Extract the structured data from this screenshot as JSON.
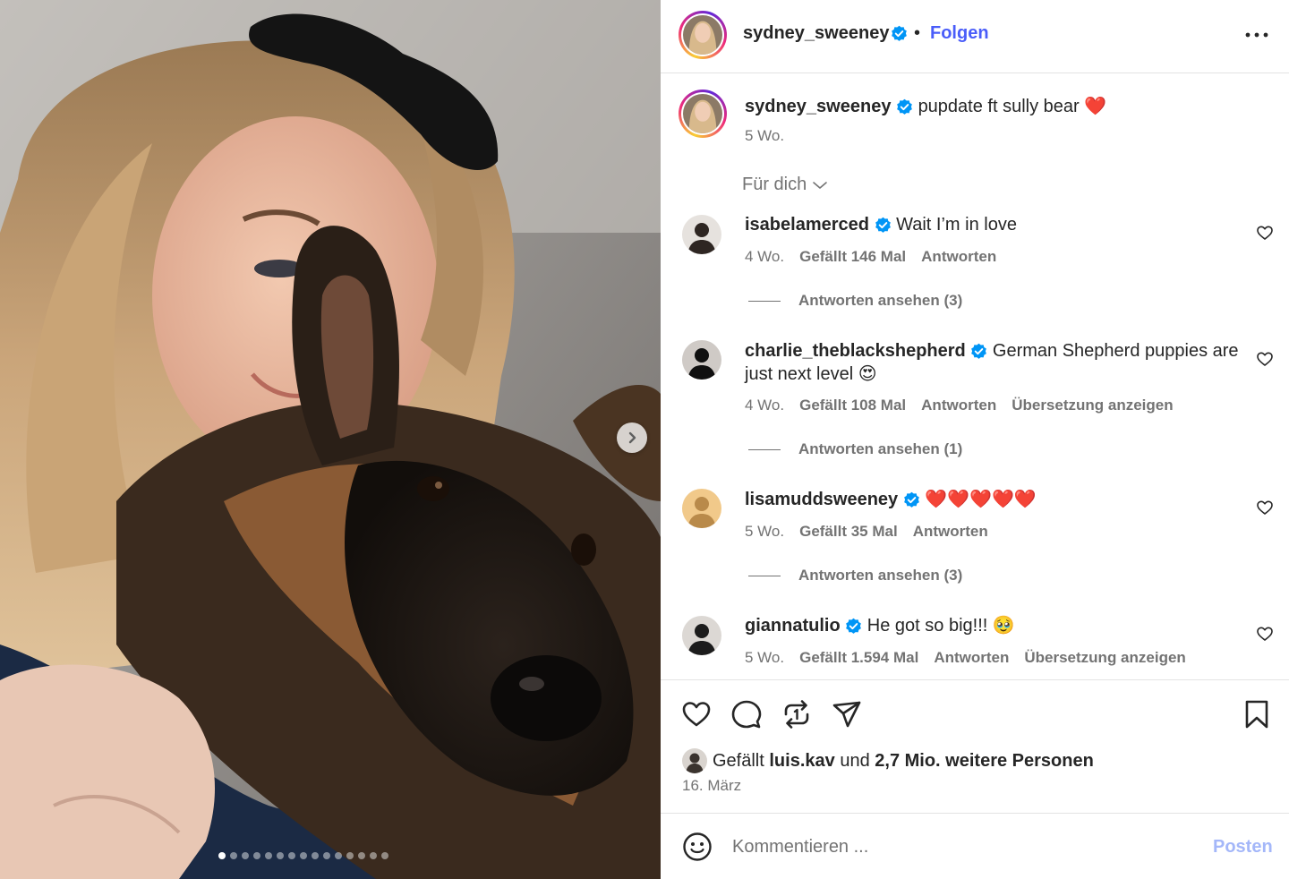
{
  "media": {
    "carousel": {
      "total_slides": 15,
      "current_slide": 1
    }
  },
  "post": {
    "username": "sydney_sweeney",
    "separator": "•",
    "follow_label": "Folgen",
    "caption_text": "pupdate ft sully bear",
    "caption_emoji": "❤️",
    "caption_time": "5 Wo."
  },
  "comments_header": {
    "label": "Für dich"
  },
  "comments": [
    {
      "username": "isabelamerced",
      "text": "Wait I’m in love",
      "time": "4 Wo.",
      "likes": "Gefällt 146 Mal",
      "reply_label": "Antworten",
      "translate_label": "",
      "view_replies": "Antworten ansehen (3)"
    },
    {
      "username": "charlie_theblackshepherd",
      "text": "German Shepherd puppies are just next level 😍",
      "time": "4 Wo.",
      "likes": "Gefällt 108 Mal",
      "reply_label": "Antworten",
      "translate_label": "Übersetzung anzeigen",
      "view_replies": "Antworten ansehen (1)"
    },
    {
      "username": "lisamuddsweeney",
      "text": "❤️❤️❤️❤️❤️",
      "time": "5 Wo.",
      "likes": "Gefällt 35 Mal",
      "reply_label": "Antworten",
      "translate_label": "",
      "view_replies": "Antworten ansehen (3)"
    },
    {
      "username": "giannatulio",
      "text": "He got so big!!! 🥹",
      "time": "5 Wo.",
      "likes": "Gefällt 1.594 Mal",
      "reply_label": "Antworten",
      "translate_label": "Übersetzung anzeigen",
      "view_replies": ""
    }
  ],
  "likes_summary": {
    "prefix": "Gefällt",
    "user": "luis.kav",
    "middle": "und",
    "count": "2,7 Mio. weitere Personen"
  },
  "date": "16. März",
  "comment_bar": {
    "placeholder": "Kommentieren ...",
    "post_label": "Posten"
  },
  "icons": {
    "verified": "verified-badge-icon",
    "more": "more-options-icon",
    "like": "heart-icon",
    "comment": "comment-icon",
    "repost": "repost-icon",
    "share": "share-icon",
    "save": "bookmark-icon",
    "emoji": "emoji-icon",
    "next": "chevron-right-icon"
  },
  "colors": {
    "link": "#4a5df9",
    "verified": "#0095f6",
    "muted": "#737373",
    "post_disabled": "#a4b7f9"
  }
}
